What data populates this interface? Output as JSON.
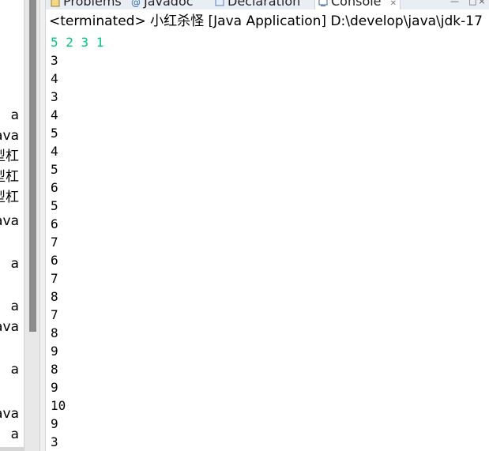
{
  "package_explorer": {
    "items": [
      {
        "label": "a"
      },
      {
        "label": "ava"
      },
      {
        "label": "型杠"
      },
      {
        "label": "数型杠"
      },
      {
        "label": "型杠"
      },
      {
        "label": "ava"
      },
      {
        "label": "a"
      },
      {
        "label": "a"
      },
      {
        "label": ".java"
      },
      {
        "label": "a"
      },
      {
        "label": "ava"
      },
      {
        "label": "a"
      }
    ]
  },
  "tabs": [
    {
      "label": "Problems",
      "icon": "problems-icon"
    },
    {
      "label": "Javadoc",
      "icon": "javadoc-icon"
    },
    {
      "label": "Declaration",
      "icon": "declaration-icon"
    },
    {
      "label": "Console",
      "icon": "console-icon",
      "active": true,
      "close_glyph": "✕"
    }
  ],
  "view_controls": {
    "minimize_glyph": "—",
    "maximize_glyph": "□",
    "close_glyph": "×"
  },
  "console": {
    "header": "<terminated> 小红杀怪 [Java Application] D:\\develop\\java\\jdk-17",
    "input_line": "5 2 3 1",
    "output_lines": [
      "3",
      "4",
      "3",
      "4",
      "5",
      "4",
      "5",
      "6",
      "5",
      "6",
      "7",
      "6",
      "7",
      "8",
      "7",
      "8",
      "9",
      "8",
      "9",
      "10",
      "9",
      "3"
    ]
  },
  "colors": {
    "stdin_text": "#00c87d",
    "stdout_text": "#000000",
    "tab_bar_bg": "#e9eef5",
    "scrollbar_thumb": "#8c8c8c"
  }
}
